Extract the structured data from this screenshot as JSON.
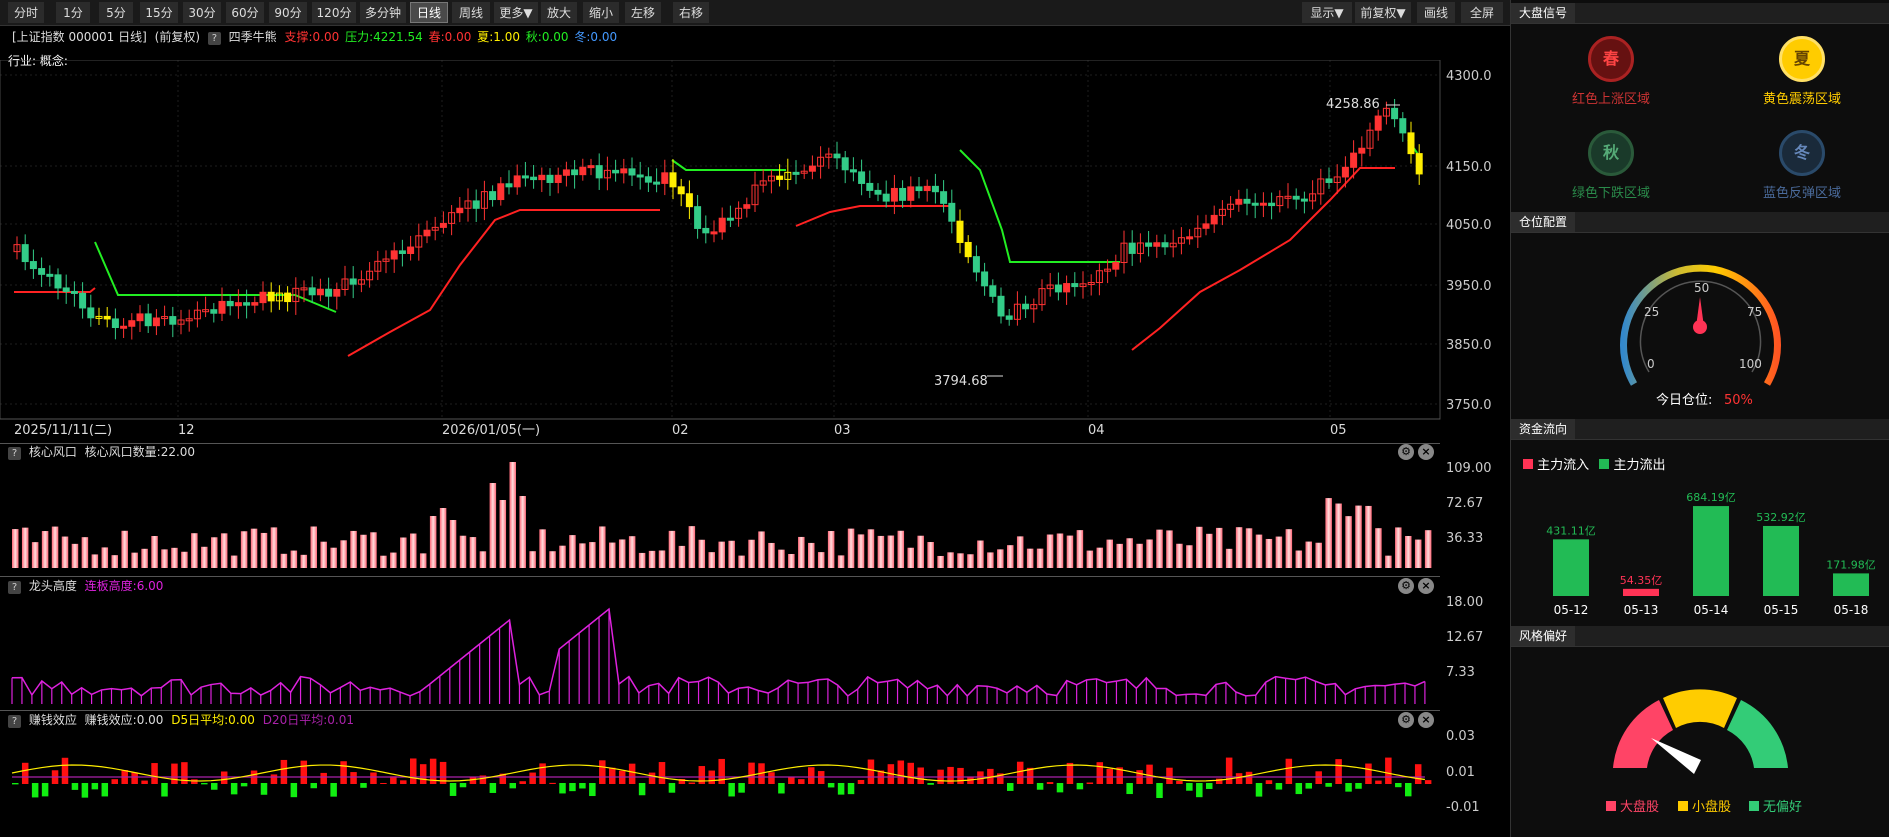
{
  "toolbar": {
    "items": [
      "分时",
      "1分",
      "5分",
      "15分",
      "30分",
      "60分",
      "90分",
      "120分",
      "多分钟",
      "日线",
      "周线",
      "更多▼",
      "放大",
      "缩小",
      "左移",
      "右移"
    ],
    "right_items": [
      "显示▼",
      "前复权▼",
      "画线",
      "全屏"
    ]
  },
  "info": {
    "title": "[上证指数 000001 日线]",
    "adjust": "(前复权)",
    "help": "?",
    "indicator": "四季牛熊",
    "support": "支撑:0.00",
    "pressure": "压力:4221.54",
    "spring": "春:0.00",
    "summer": "夏:1.00",
    "autumn": "秋:0.00",
    "winter": "冬:0.00",
    "industry": "行业: 概念:"
  },
  "colors": {
    "up": "#ff3333",
    "down": "#33cc66",
    "yellow": "#ffee00",
    "support": "#ff2222",
    "pressure": "#22ee22",
    "magenta": "#dd22dd"
  },
  "main_chart": {
    "y_ticks": [
      "4300.0",
      "4150.0",
      "4050.0",
      "3950.0",
      "3850.0",
      "3750.0"
    ],
    "x_labels": [
      "2025/11/11(二)",
      "12",
      "2026/01/05(一)",
      "02",
      "03",
      "04",
      "05"
    ],
    "high_label": "4258.86",
    "low_label": "3794.68"
  },
  "panel1": {
    "help": "?",
    "title": "核心风口",
    "value": "核心风口数量:22.00",
    "y_ticks": [
      "109.00",
      "72.67",
      "36.33"
    ]
  },
  "panel2": {
    "help": "?",
    "title": "龙头高度",
    "value": "连板高度:6.00",
    "y_ticks": [
      "18.00",
      "12.67",
      "7.33"
    ]
  },
  "panel3": {
    "help": "?",
    "title": "赚钱效应",
    "value": "赚钱效应:0.00",
    "d5": "D5日平均:0.00",
    "d20": "D20日平均:0.01",
    "y_ticks": [
      "0.03",
      "0.01",
      "-0.01"
    ]
  },
  "right": {
    "signal_title": "大盘信号",
    "signals": [
      {
        "icon": "春",
        "label": "红色上涨区域",
        "color": "#cc2222"
      },
      {
        "icon": "夏",
        "label": "黄色震荡区域",
        "color": "#ffcc00"
      },
      {
        "icon": "秋",
        "label": "绿色下跌区域",
        "color": "#2a7a4a"
      },
      {
        "icon": "冬",
        "label": "蓝色反弹区域",
        "color": "#3a5a8a"
      }
    ],
    "position_title": "仓位配置",
    "gauge_ticks": [
      "0",
      "25",
      "50",
      "75",
      "100"
    ],
    "position_label": "今日仓位:",
    "position_value": "50%",
    "position_level": 0.5,
    "flow_title": "资金流向",
    "flow_legend_in": "主力流入",
    "flow_legend_out": "主力流出",
    "flows": [
      {
        "date": "05-12",
        "value": 431.11,
        "label": "431.11亿",
        "dir": "out"
      },
      {
        "date": "05-13",
        "value": 54.35,
        "label": "54.35亿",
        "dir": "in"
      },
      {
        "date": "05-14",
        "value": 684.19,
        "label": "684.19亿",
        "dir": "out"
      },
      {
        "date": "05-15",
        "value": 532.92,
        "label": "532.92亿",
        "dir": "out"
      },
      {
        "date": "05-18",
        "value": 171.98,
        "label": "171.98亿",
        "dir": "out"
      }
    ],
    "style_title": "风格偏好",
    "style_legend": [
      "大盘股",
      "小盘股",
      "无偏好"
    ],
    "style_colors": [
      "#ff4466",
      "#ffcc00",
      "#33cc77"
    ]
  }
}
